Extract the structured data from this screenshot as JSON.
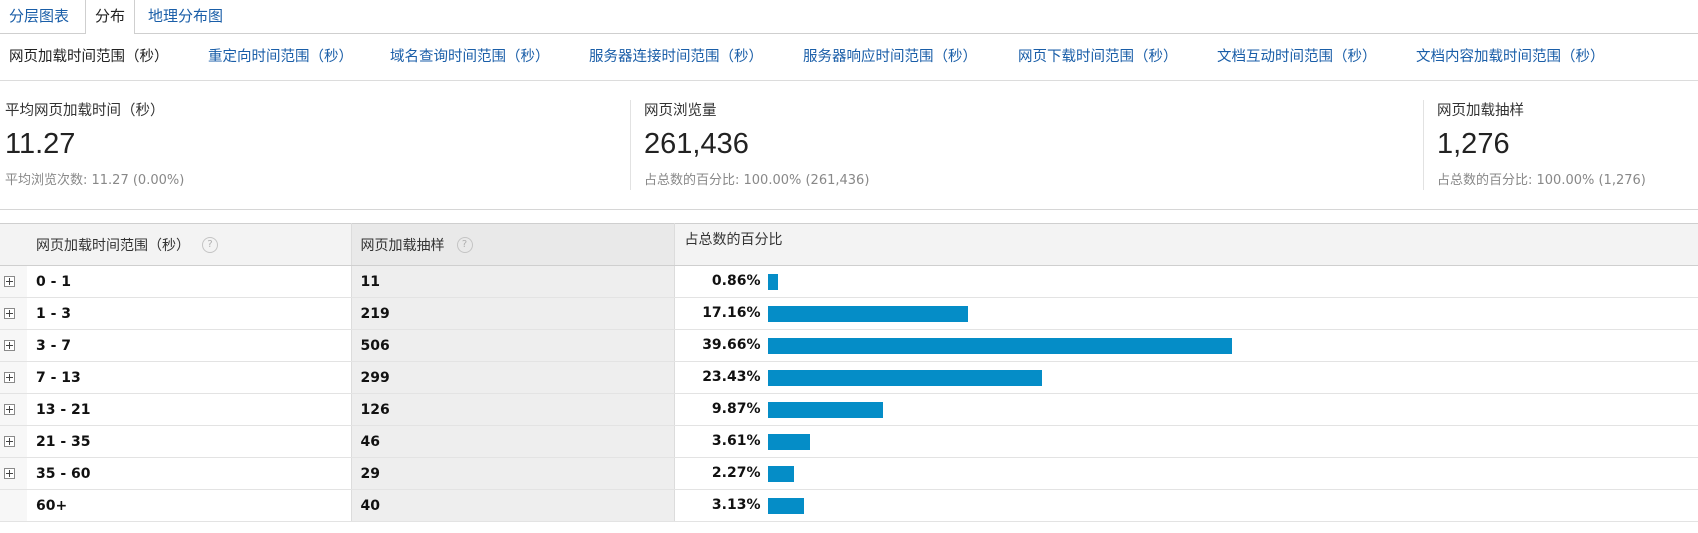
{
  "tabs": [
    {
      "label": "分层图表",
      "active": false
    },
    {
      "label": "分布",
      "active": true
    },
    {
      "label": "地理分布图",
      "active": false
    }
  ],
  "subnav": [
    {
      "label": "网页加载时间范围（秒）",
      "active": true
    },
    {
      "label": "重定向时间范围（秒）",
      "active": false
    },
    {
      "label": "域名查询时间范围（秒）",
      "active": false
    },
    {
      "label": "服务器连接时间范围（秒）",
      "active": false
    },
    {
      "label": "服务器响应时间范围（秒）",
      "active": false
    },
    {
      "label": "网页下载时间范围（秒）",
      "active": false
    },
    {
      "label": "文档互动时间范围（秒）",
      "active": false
    },
    {
      "label": "文档内容加载时间范围（秒）",
      "active": false
    }
  ],
  "metrics": [
    {
      "label": "平均网页加载时间（秒）",
      "value": "11.27",
      "sub": "平均浏览次数: 11.27 (0.00%)"
    },
    {
      "label": "网页浏览量",
      "value": "261,436",
      "sub": "占总数的百分比: 100.00% (261,436)"
    },
    {
      "label": "网页加载抽样",
      "value": "1,276",
      "sub": "占总数的百分比: 100.00% (1,276)"
    }
  ],
  "table": {
    "headers": {
      "dimension": "网页加载时间范围（秒）",
      "samples": "网页加载抽样",
      "percent": "占总数的百分比"
    },
    "help_icon": "?",
    "bar_color": "#058dc7",
    "rows": [
      {
        "range": "0 - 1",
        "samples": "11",
        "percent": "0.86%",
        "share": 0.86,
        "expandable": true
      },
      {
        "range": "1 - 3",
        "samples": "219",
        "percent": "17.16%",
        "share": 17.16,
        "expandable": true
      },
      {
        "range": "3 - 7",
        "samples": "506",
        "percent": "39.66%",
        "share": 39.66,
        "expandable": true
      },
      {
        "range": "7 - 13",
        "samples": "299",
        "percent": "23.43%",
        "share": 23.43,
        "expandable": true
      },
      {
        "range": "13 - 21",
        "samples": "126",
        "percent": "9.87%",
        "share": 9.87,
        "expandable": true
      },
      {
        "range": "21 - 35",
        "samples": "46",
        "percent": "3.61%",
        "share": 3.61,
        "expandable": true
      },
      {
        "range": "35 - 60",
        "samples": "29",
        "percent": "2.27%",
        "share": 2.27,
        "expandable": true
      },
      {
        "range": "60+",
        "samples": "40",
        "percent": "3.13%",
        "share": 3.13,
        "expandable": false
      }
    ]
  }
}
